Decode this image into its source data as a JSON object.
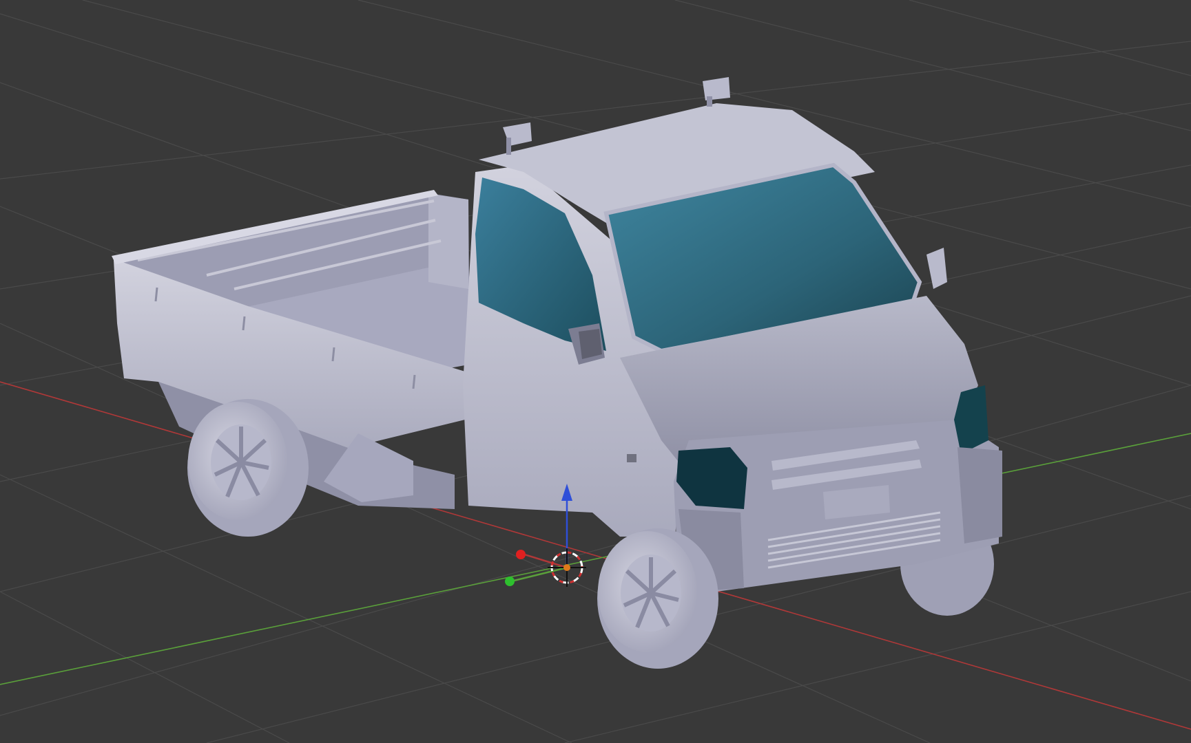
{
  "app": {
    "view": "3D Viewport",
    "shading": "solid",
    "object": "kei-truck-mesh"
  },
  "colors": {
    "background": "#393939",
    "grid": "#4a4a4a",
    "x_axis": "#b03838",
    "y_axis": "#5aa03a",
    "z_axis": "#2f4fd8",
    "body": "#c4c4d2",
    "body_shadow": "#8f90a6",
    "glass": "#2f6b82",
    "glass_dark": "#123a44",
    "cursor_center": "#e07a1a"
  },
  "gizmo": {
    "x_handle": "red",
    "y_handle": "green",
    "z_handle": "blue"
  }
}
